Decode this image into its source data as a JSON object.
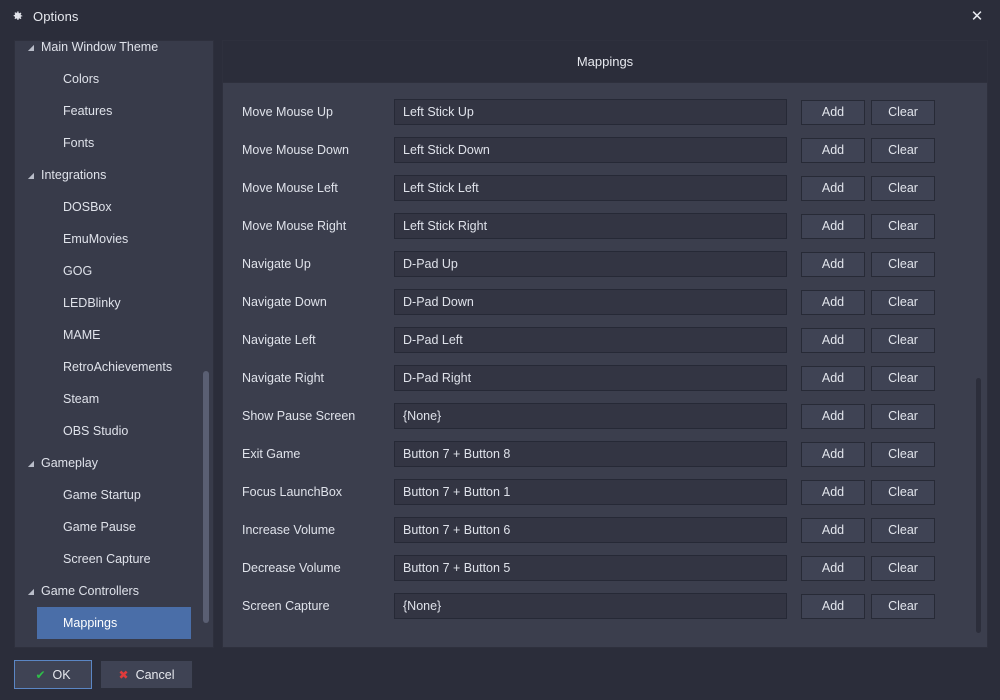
{
  "window": {
    "title": "Options",
    "icon": "gear-icon",
    "close_label": "✕",
    "accent_selected": "#4a6ea8",
    "background": "#2b2d3a"
  },
  "sidebar": {
    "items": [
      {
        "label": "Main Window Theme",
        "level": 0,
        "arrow": "◢",
        "selected": false
      },
      {
        "label": "Colors",
        "level": 1,
        "arrow": "",
        "selected": false
      },
      {
        "label": "Features",
        "level": 1,
        "arrow": "",
        "selected": false
      },
      {
        "label": "Fonts",
        "level": 1,
        "arrow": "",
        "selected": false
      },
      {
        "label": "Integrations",
        "level": 0,
        "arrow": "◢",
        "selected": false
      },
      {
        "label": "DOSBox",
        "level": 1,
        "arrow": "",
        "selected": false
      },
      {
        "label": "EmuMovies",
        "level": 1,
        "arrow": "",
        "selected": false
      },
      {
        "label": "GOG",
        "level": 1,
        "arrow": "",
        "selected": false
      },
      {
        "label": "LEDBlinky",
        "level": 1,
        "arrow": "",
        "selected": false
      },
      {
        "label": "MAME",
        "level": 1,
        "arrow": "",
        "selected": false
      },
      {
        "label": "RetroAchievements",
        "level": 1,
        "arrow": "",
        "selected": false
      },
      {
        "label": "Steam",
        "level": 1,
        "arrow": "",
        "selected": false
      },
      {
        "label": "OBS Studio",
        "level": 1,
        "arrow": "",
        "selected": false
      },
      {
        "label": "Gameplay",
        "level": 0,
        "arrow": "◢",
        "selected": false
      },
      {
        "label": "Game Startup",
        "level": 1,
        "arrow": "",
        "selected": false
      },
      {
        "label": "Game Pause",
        "level": 1,
        "arrow": "",
        "selected": false
      },
      {
        "label": "Screen Capture",
        "level": 1,
        "arrow": "",
        "selected": false
      },
      {
        "label": "Game Controllers",
        "level": 0,
        "arrow": "◢",
        "selected": false
      },
      {
        "label": "Mappings",
        "level": 1,
        "arrow": "",
        "selected": true
      }
    ]
  },
  "main": {
    "header_title": "Mappings",
    "add_label": "Add",
    "clear_label": "Clear",
    "rows": [
      {
        "action": "Move Mouse Up",
        "binding": "Left Stick Up"
      },
      {
        "action": "Move Mouse Down",
        "binding": "Left Stick Down"
      },
      {
        "action": "Move Mouse Left",
        "binding": "Left Stick Left"
      },
      {
        "action": "Move Mouse Right",
        "binding": "Left Stick Right"
      },
      {
        "action": "Navigate Up",
        "binding": "D-Pad Up"
      },
      {
        "action": "Navigate Down",
        "binding": "D-Pad Down"
      },
      {
        "action": "Navigate Left",
        "binding": "D-Pad Left"
      },
      {
        "action": "Navigate Right",
        "binding": "D-Pad Right"
      },
      {
        "action": "Show Pause Screen",
        "binding": "{None}"
      },
      {
        "action": "Exit Game",
        "binding": "Button 7 + Button 8"
      },
      {
        "action": "Focus LaunchBox",
        "binding": "Button 7 + Button 1"
      },
      {
        "action": "Increase Volume",
        "binding": "Button 7 + Button 6"
      },
      {
        "action": "Decrease Volume",
        "binding": "Button 7 + Button 5"
      },
      {
        "action": "Screen Capture",
        "binding": "{None}"
      }
    ]
  },
  "footer": {
    "ok_label": "OK",
    "ok_glyph": "✔",
    "ok_glyph_color": "#2fbf4a",
    "cancel_label": "Cancel",
    "cancel_glyph": "✖",
    "cancel_glyph_color": "#e03b3b"
  }
}
